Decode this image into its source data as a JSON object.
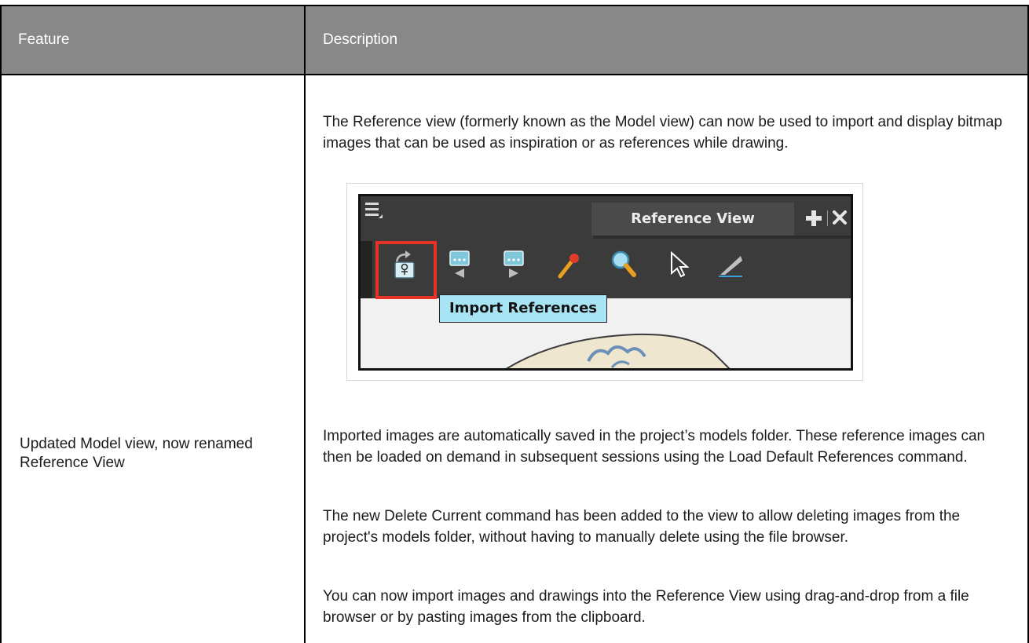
{
  "table": {
    "headers": {
      "feature": "Feature",
      "description": "Description"
    },
    "row": {
      "feature": "Updated Model view, now renamed Reference View",
      "paragraphs": [
        "The Reference view (formerly known as the Model view) can now be used to import and display bitmap images that can be used as inspiration or as references while drawing.",
        "Imported images are automatically saved in the project’s models folder. These reference images can then be loaded on demand in subsequent sessions using the Load Default References command.",
        "The new Delete Current command has been added to the view to allow deleting images from the project's models folder, without having to manually delete using the file browser.",
        "You can now import images and drawings into the Reference View using drag-and-drop from a file browser or by pasting images from the clipboard."
      ]
    }
  },
  "figure": {
    "tab_title": "Reference View",
    "tooltip": "Import References",
    "icons": [
      "menu-icon",
      "add-view-icon",
      "close-icon",
      "import-references-icon",
      "previous-reference-icon",
      "next-reference-icon",
      "color-picker-icon",
      "zoom-icon",
      "select-icon",
      "pencil-icon"
    ],
    "highlight_color": "#e53424",
    "tooltip_color": "#a9e4f4"
  }
}
